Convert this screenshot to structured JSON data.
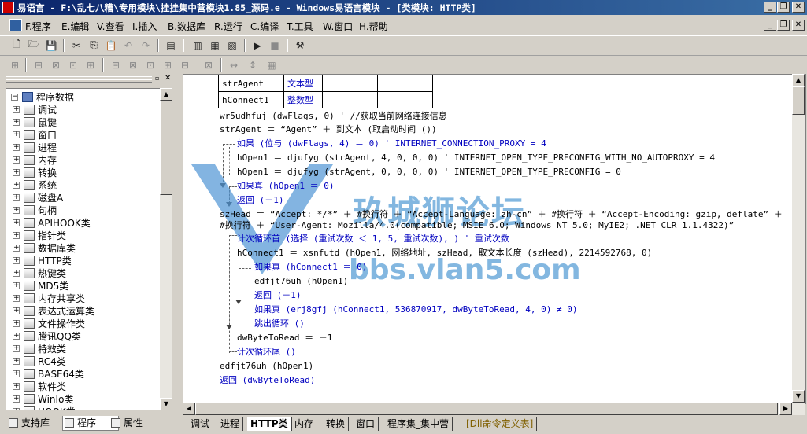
{
  "window": {
    "title": "易语言 - F:\\乱七八糟\\专用模块\\挂挂集中营模块1.85_源码.e - Windows易语言模块 - [类模块: HTTP类]"
  },
  "menu": {
    "items": [
      {
        "key": "F",
        "label": "F.程序"
      },
      {
        "key": "E",
        "label": "E.编辑"
      },
      {
        "key": "V",
        "label": "V.查看"
      },
      {
        "key": "I",
        "label": "I.插入"
      },
      {
        "key": "B",
        "label": "B.数据库"
      },
      {
        "key": "R",
        "label": "R.运行"
      },
      {
        "key": "C",
        "label": "C.编译"
      },
      {
        "key": "T",
        "label": "T.工具"
      },
      {
        "key": "W",
        "label": "W.窗口"
      },
      {
        "key": "H",
        "label": "H.帮助"
      }
    ]
  },
  "tree": {
    "root": "程序数据",
    "items": [
      "调试",
      "鼠键",
      "窗口",
      "进程",
      "内存",
      "转换",
      "系统",
      "磁盘A",
      "句柄",
      "APIHOOK类",
      "指针类",
      "数据库类",
      "HTTP类",
      "热键类",
      "MD5类",
      "内存共享类",
      "表达式运算类",
      "文件操作类",
      "腾讯QQ类",
      "特效类",
      "RC4类",
      "BASE64类",
      "软件类",
      "WinIo类",
      "HOOK类"
    ]
  },
  "left_tabs": [
    "支持库",
    "程序",
    "属性"
  ],
  "vars_table": [
    {
      "name": "strAgent",
      "type": "文本型"
    },
    {
      "name": "hConnect1",
      "type": "整数型"
    }
  ],
  "code": [
    "wr5udhfuj (dwFlags, 0)  ' //获取当前网络连接信息",
    "strAgent ＝ “Agent” ＋ 到文本 (取启动时间 ())",
    "如果 (位与 (dwFlags, 4) ＝ 0)  ' INTERNET_CONNECTION_PROXY = 4",
    "hOpen1 ＝ djufyg (strAgent, 4, 0, 0, 0)  ' INTERNET_OPEN_TYPE_PRECONFIG_WITH_NO_AUTOPROXY = 4",
    "hOpen1 ＝ djufyg (strAgent, 0, 0, 0, 0)  ' INTERNET_OPEN_TYPE_PRECONFIG = 0",
    "如果真 (hOpen1 ＝ 0)",
    "返回 (－1)",
    "szHead ＝ “Accept: */*” ＋ #换行符 ＋ “Accept-Language: zh-cn” ＋ #换行符 ＋ “Accept-Encoding: gzip, deflate” ＋",
    "#换行符 ＋ “User-Agent: Mozilla/4.0(compatible; MSIE 6.0; Windows NT 5.0; MyIE2; .NET CLR 1.1.4322)”",
    "计次循环首 (选择 (重试次数 ＜ 1, 5, 重试次数), )  ' 重试次数",
    "hConnect1 ＝ xsnfutd (hOpen1, 网络地址, szHead, 取文本长度 (szHead), 2214592768, 0)",
    "如果真 (hConnect1 ＝ 0)",
    "edfjt76uh (hOpen1)",
    "返回 (－1)",
    "如果真 (erj8gfj (hConnect1, 536870917, dwByteToRead, 4, 0) ≠ 0)",
    "跳出循环 ()",
    "dwByteToRead ＝ －1",
    "计次循环尾 ()",
    "edfjt76uh (hOpen1)",
    "返回 (dwByteToRead)"
  ],
  "watermark": {
    "cn": "玖城狮论坛",
    "url": "bbs.vlan5.com"
  },
  "bottom_tabs": [
    "调试",
    "进程",
    "HTTP类",
    "内存",
    "转换",
    "窗口",
    "程序集_集中营",
    "[Dll命令定义表]"
  ],
  "colors": {
    "keyword": "#0000c0",
    "comment": "#008000",
    "string": "#c00000",
    "title_start": "#0a246a",
    "title_end": "#3a6ea5"
  }
}
